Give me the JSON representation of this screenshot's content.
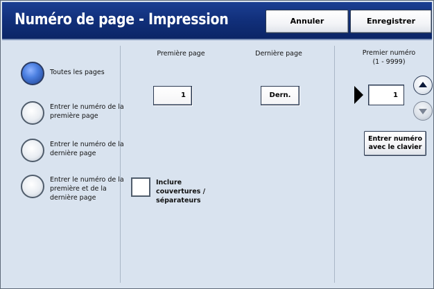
{
  "header": {
    "title": "Numéro de page - Impression",
    "cancel_label": "Annuler",
    "save_label": "Enregistrer"
  },
  "radio_options": [
    {
      "label": "Toutes les pages",
      "selected": true
    },
    {
      "label": "Entrer le numéro de la première page",
      "selected": false
    },
    {
      "label": "Entrer le numéro de la dernière page",
      "selected": false
    },
    {
      "label": "Entrer le numéro de la première et de la dernière page",
      "selected": false
    }
  ],
  "first_page": {
    "label": "Première page",
    "value": "1"
  },
  "last_page": {
    "label": "Dernière page",
    "value": "Dern."
  },
  "include_covers": {
    "label": "Inclure couvertures / séparateurs",
    "checked": false
  },
  "first_number": {
    "label": "Premier numéro",
    "range": "(1 - 9999)",
    "value": "1",
    "keypad_button": "Entrer numéro avec le clavier"
  },
  "icons": {
    "increment": "triangle-up-icon",
    "decrement": "triangle-down-icon",
    "current_field": "pointer-arrow-icon"
  },
  "colors": {
    "title_bar": "#112f7a",
    "panel": "#d9e3ef",
    "selected_radio": "#4b7fe0"
  }
}
